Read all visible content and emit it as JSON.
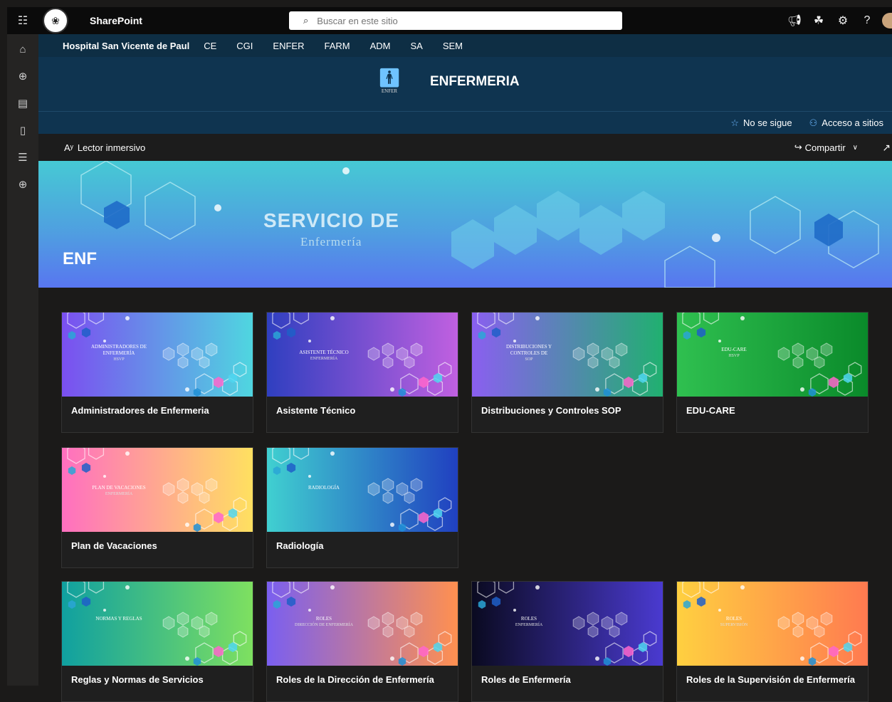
{
  "suitebar": {
    "app_name": "SharePoint",
    "search_placeholder": "Buscar en este sitio",
    "icons": [
      "app-launcher-icon",
      "megaphone-icon",
      "sites-icon",
      "settings-icon",
      "help-icon"
    ],
    "help_glyph": "?"
  },
  "hubnav": {
    "title": "Hospital San Vicente de Paul",
    "links": [
      "CE",
      "CGI",
      "ENFER",
      "FARM",
      "ADM",
      "SA",
      "SEM"
    ]
  },
  "site": {
    "title": "ENFERMERIA",
    "logo_caption": "ENFER"
  },
  "followbar": {
    "follow_label": "No se sigue",
    "access_label": "Acceso a sitios"
  },
  "commandbar": {
    "reader_label": "Lector inmersivo",
    "share_label": "Compartir"
  },
  "hero": {
    "title": "SERVICIO DE",
    "subtitle": "Enfermería",
    "name": "ENF"
  },
  "cards": [
    {
      "label": "Administradores de Enfermeria",
      "thumb_title": "ADMINISTRADORES DE ENFERMERÍA",
      "thumb_sub": "HSVP",
      "colors": [
        "#7b4ff0",
        "#4fd6e0"
      ]
    },
    {
      "label": "Asistente Técnico",
      "thumb_title": "ASISTENTE TÉCNICO",
      "thumb_sub": "Enfermería",
      "colors": [
        "#2f3fc0",
        "#c060e0"
      ]
    },
    {
      "label": "Distribuciones y Controles SOP",
      "thumb_title": "DISTRIBUCIONES Y CONTROLES DE",
      "thumb_sub": "SOP",
      "colors": [
        "#8a5ff0",
        "#20b070"
      ]
    },
    {
      "label": "EDU-CARE",
      "thumb_title": "EDU-CARE",
      "thumb_sub": "HSVP",
      "colors": [
        "#2fc050",
        "#0a8a2a"
      ]
    },
    {
      "label": "Plan de Vacaciones",
      "thumb_title": "PLAN DE VACACIONES",
      "thumb_sub": "ENFERMERÍA",
      "colors": [
        "#ff6fc0",
        "#ffe060"
      ]
    },
    {
      "label": "Radiología",
      "thumb_title": "RADIOLOGÍA",
      "thumb_sub": "",
      "colors": [
        "#40d0d0",
        "#2040c0"
      ]
    },
    {
      "label": "Reglas y Normas de Servicios",
      "thumb_title": "NORMAS Y REGLAS",
      "thumb_sub": "",
      "colors": [
        "#10a0a0",
        "#7ee060"
      ]
    },
    {
      "label": "Roles de la Dirección de Enfermería",
      "thumb_title": "ROLES",
      "thumb_sub": "DIRECCIÓN DE ENFERMERÍA",
      "colors": [
        "#7a5ff0",
        "#ff9050"
      ]
    },
    {
      "label": "Roles de Enfermería",
      "thumb_title": "ROLES",
      "thumb_sub": "ENFERMERÍA",
      "colors": [
        "#0a0a20",
        "#4a3ad0"
      ]
    },
    {
      "label": "Roles de la Supervisión de Enfermería",
      "thumb_title": "ROLES",
      "thumb_sub": "SUPERVISIÓN",
      "colors": [
        "#ffd040",
        "#ff7a50"
      ]
    }
  ]
}
